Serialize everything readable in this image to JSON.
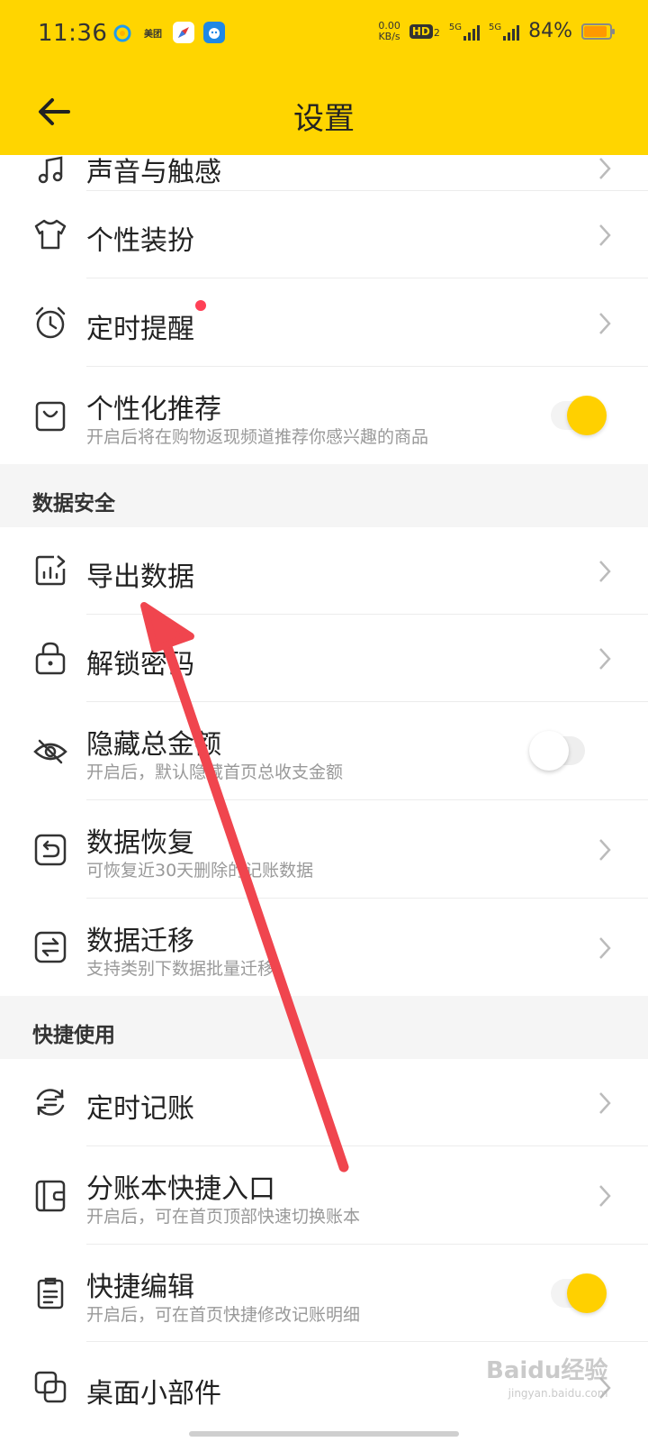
{
  "status_bar": {
    "time": "11:36",
    "app_meituan": "美团",
    "net_speed_value": "0.00",
    "net_speed_unit": "KB/s",
    "hd": "HD",
    "hd_sub": "2",
    "sim1": "5G",
    "sim2": "5G",
    "battery_pct": "84%"
  },
  "header": {
    "title": "设置",
    "back_icon": "arrow-left-icon",
    "background": "#FFD500"
  },
  "rows": {
    "sound": {
      "label": "声音与触感"
    },
    "personalize": {
      "label": "个性装扮"
    },
    "reminder": {
      "label": "定时提醒"
    },
    "recommend": {
      "label": "个性化推荐",
      "sub": "开启后将在购物返现频道推荐你感兴趣的商品",
      "toggle": "on"
    },
    "export": {
      "label": "导出数据"
    },
    "unlock": {
      "label": "解锁密码"
    },
    "hide_amount": {
      "label": "隐藏总金额",
      "sub": "开启后，默认隐藏首页总收支金额",
      "toggle": "off"
    },
    "restore": {
      "label": "数据恢复",
      "sub": "可恢复近30天删除的记账数据"
    },
    "migrate": {
      "label": "数据迁移",
      "sub": "支持类别下数据批量迁移"
    },
    "scheduled": {
      "label": "定时记账"
    },
    "book_entry": {
      "label": "分账本快捷入口",
      "sub": "开启后，可在首页顶部快速切换账本"
    },
    "quick_edit": {
      "label": "快捷编辑",
      "sub": "开启后，可在首页快捷修改记账明细",
      "toggle": "on"
    },
    "widget": {
      "label": "桌面小部件"
    }
  },
  "sections": {
    "data_security": "数据安全",
    "quick_use": "快捷使用"
  },
  "watermark": {
    "text": "Baidu经验",
    "sub": "jingyan.baidu.com"
  },
  "colors": {
    "accent": "#FFD000",
    "annotation": "#F0454E",
    "badge": "#FF4056"
  }
}
